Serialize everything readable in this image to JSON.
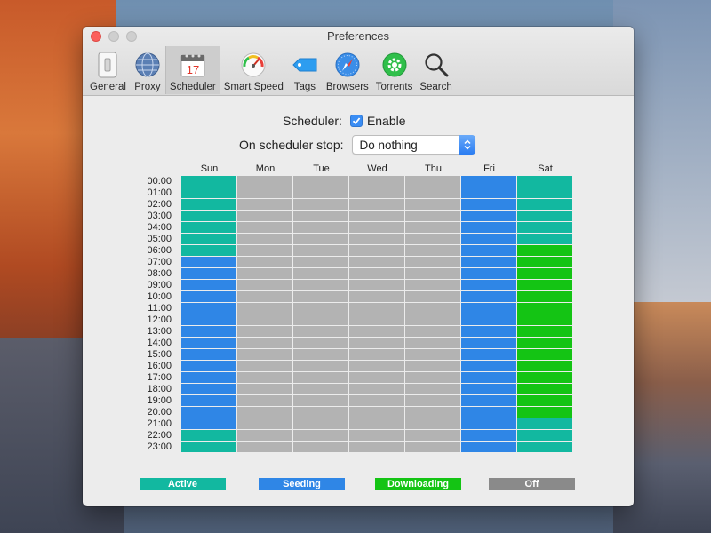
{
  "window": {
    "title": "Preferences"
  },
  "toolbar": {
    "items": [
      {
        "label": "General",
        "icon": "switch-icon"
      },
      {
        "label": "Proxy",
        "icon": "globe-icon"
      },
      {
        "label": "Scheduler",
        "icon": "calendar-icon",
        "selected": true,
        "calendar_day": "17"
      },
      {
        "label": "Smart Speed",
        "icon": "speedometer-icon"
      },
      {
        "label": "Tags",
        "icon": "tag-icon"
      },
      {
        "label": "Browsers",
        "icon": "compass-icon"
      },
      {
        "label": "Torrents",
        "icon": "gear-icon"
      },
      {
        "label": "Search",
        "icon": "magnifier-icon"
      }
    ]
  },
  "scheduler": {
    "label": "Scheduler:",
    "enable_label": "Enable",
    "enabled": true,
    "stop_label": "On scheduler stop:",
    "stop_value": "Do nothing"
  },
  "days": [
    "Sun",
    "Mon",
    "Tue",
    "Wed",
    "Thu",
    "Fri",
    "Sat"
  ],
  "hours": [
    "00:00",
    "01:00",
    "02:00",
    "03:00",
    "04:00",
    "05:00",
    "06:00",
    "07:00",
    "08:00",
    "09:00",
    "10:00",
    "11:00",
    "12:00",
    "13:00",
    "14:00",
    "15:00",
    "16:00",
    "17:00",
    "18:00",
    "19:00",
    "20:00",
    "21:00",
    "22:00",
    "23:00"
  ],
  "schedule": {
    "Sun": [
      "A",
      "A",
      "A",
      "A",
      "A",
      "A",
      "A",
      "S",
      "S",
      "S",
      "S",
      "S",
      "S",
      "S",
      "S",
      "S",
      "S",
      "S",
      "S",
      "S",
      "S",
      "S",
      "A",
      "A"
    ],
    "Mon": [
      "O",
      "O",
      "O",
      "O",
      "O",
      "O",
      "O",
      "O",
      "O",
      "O",
      "O",
      "O",
      "O",
      "O",
      "O",
      "O",
      "O",
      "O",
      "O",
      "O",
      "O",
      "O",
      "O",
      "O"
    ],
    "Tue": [
      "O",
      "O",
      "O",
      "O",
      "O",
      "O",
      "O",
      "O",
      "O",
      "O",
      "O",
      "O",
      "O",
      "O",
      "O",
      "O",
      "O",
      "O",
      "O",
      "O",
      "O",
      "O",
      "O",
      "O"
    ],
    "Wed": [
      "O",
      "O",
      "O",
      "O",
      "O",
      "O",
      "O",
      "O",
      "O",
      "O",
      "O",
      "O",
      "O",
      "O",
      "O",
      "O",
      "O",
      "O",
      "O",
      "O",
      "O",
      "O",
      "O",
      "O"
    ],
    "Thu": [
      "O",
      "O",
      "O",
      "O",
      "O",
      "O",
      "O",
      "O",
      "O",
      "O",
      "O",
      "O",
      "O",
      "O",
      "O",
      "O",
      "O",
      "O",
      "O",
      "O",
      "O",
      "O",
      "O",
      "O"
    ],
    "Fri": [
      "S",
      "S",
      "S",
      "S",
      "S",
      "S",
      "S",
      "S",
      "S",
      "S",
      "S",
      "S",
      "S",
      "S",
      "S",
      "S",
      "S",
      "S",
      "S",
      "S",
      "S",
      "S",
      "S",
      "S"
    ],
    "Sat": [
      "A",
      "A",
      "A",
      "A",
      "A",
      "A",
      "D",
      "D",
      "D",
      "D",
      "D",
      "D",
      "D",
      "D",
      "D",
      "D",
      "D",
      "D",
      "D",
      "D",
      "D",
      "A",
      "A",
      "A"
    ]
  },
  "legend": [
    {
      "key": "A",
      "label": "Active",
      "color": "#12b8a0"
    },
    {
      "key": "S",
      "label": "Seeding",
      "color": "#2f86e6"
    },
    {
      "key": "D",
      "label": "Downloading",
      "color": "#14c414"
    },
    {
      "key": "O",
      "label": "Off",
      "color": "#8a8a8a"
    }
  ],
  "cell_colors": {
    "A": "#12b8a0",
    "S": "#2f86e6",
    "D": "#14c414",
    "O": "#b3b3b3"
  }
}
